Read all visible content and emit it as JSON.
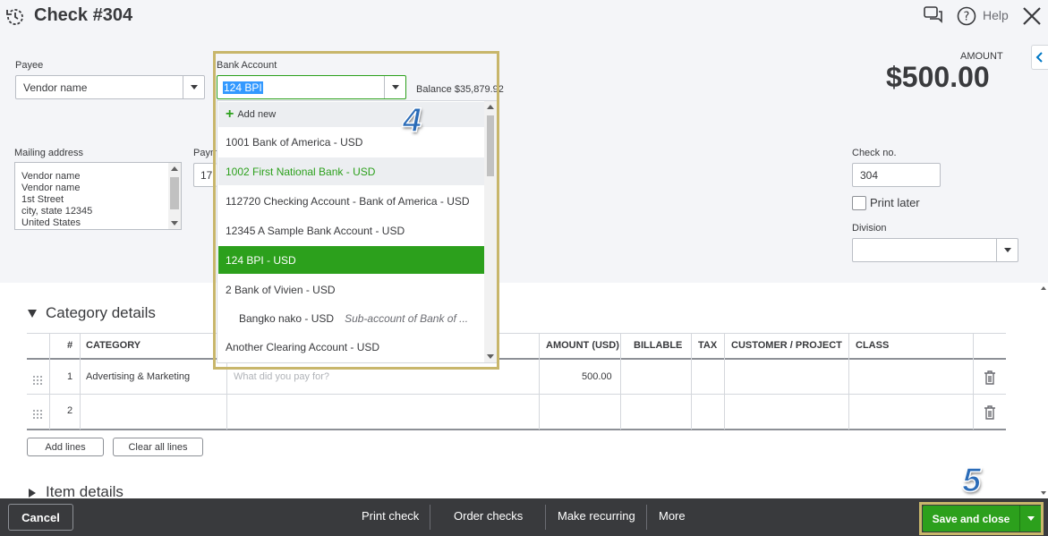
{
  "header": {
    "title": "Check #304",
    "help_label": "Help"
  },
  "payee": {
    "label": "Payee",
    "value": "Vendor name"
  },
  "bank_account": {
    "label": "Bank Account",
    "value": "124 BPI",
    "balance_label": "Balance",
    "balance_value": "$35,879.92"
  },
  "bank_dropdown": {
    "add_new": "Add new",
    "items": [
      {
        "label": "1001 Bank of America - USD",
        "state": "normal"
      },
      {
        "label": "1002 First National Bank - USD",
        "state": "hover"
      },
      {
        "label": "112720 Checking Account - Bank of America - USD",
        "state": "normal"
      },
      {
        "label": "12345 A Sample Bank Account - USD",
        "state": "normal"
      },
      {
        "label": "124 BPI - USD",
        "state": "selected"
      },
      {
        "label": "2 Bank of Vivien - USD",
        "state": "normal"
      },
      {
        "label": "Bangko nako - USD",
        "sub": "Sub-account of Bank of ...",
        "state": "normal"
      },
      {
        "label": "Another Clearing Account - USD",
        "state": "normal"
      }
    ]
  },
  "mailing_address": {
    "label": "Mailing address",
    "lines": [
      "Vendor name",
      "Vendor name",
      "1st Street",
      "city, state  12345",
      "United States"
    ]
  },
  "payment_date": {
    "label_partial": "Paym",
    "value_partial": "17"
  },
  "amount": {
    "label": "AMOUNT",
    "value": "$500.00"
  },
  "check_no": {
    "label": "Check no.",
    "value": "304"
  },
  "print_later": {
    "label": "Print later",
    "checked": false
  },
  "division": {
    "label": "Division",
    "value": ""
  },
  "category_section": {
    "title": "Category details",
    "columns": [
      "#",
      "CATEGORY",
      "AMOUNT (USD)",
      "BILLABLE",
      "TAX",
      "CUSTOMER / PROJECT",
      "CLASS"
    ],
    "rows": [
      {
        "num": "1",
        "category": "Advertising & Marketing",
        "description_placeholder": "What did you pay for?",
        "amount": "500.00"
      },
      {
        "num": "2",
        "category": "",
        "description_placeholder": "",
        "amount": ""
      }
    ],
    "add_lines": "Add lines",
    "clear_lines": "Clear all lines"
  },
  "item_section": {
    "title": "Item details"
  },
  "steps": {
    "step4": "4",
    "step5": "5"
  },
  "footer": {
    "cancel": "Cancel",
    "print_check": "Print check",
    "order_checks": "Order checks",
    "make_recurring": "Make recurring",
    "more": "More",
    "save_and_close": "Save and close"
  },
  "colors": {
    "brand_green": "#2ca01c",
    "footer_bg": "#393a3d",
    "highlight": "#c8b66b",
    "step_blue": "#2b6cb8"
  }
}
